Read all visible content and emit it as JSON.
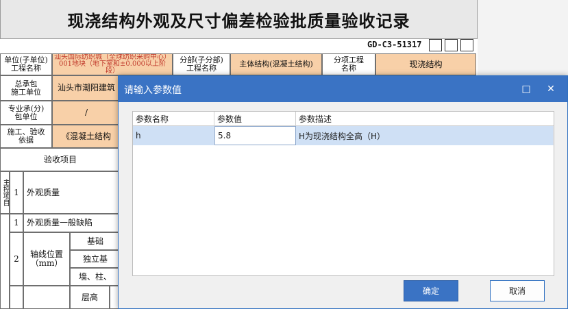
{
  "form": {
    "title": "现浇结构外观及尺寸偏差检验批质量验收记录",
    "code": "GD-C3-51317",
    "row1": {
      "unit_label": "单位(子单位)\n工程名称",
      "unit_value": "汕头国际纺织城（全球纺织采购中心）001地块（地下室和±0.000以上阶段）",
      "sub_label": "分部(子分部)\n工程名称",
      "sub_value": "主体结构(混凝土结构)",
      "item_label": "分项工程\n名称",
      "item_value": "现浇结构"
    },
    "row2": {
      "label": "总承包\n施工单位",
      "value": "汕头市潮阳建筑"
    },
    "row3": {
      "label": "专业承(分)\n包单位",
      "value": "/"
    },
    "row4": {
      "label": "施工、验收\n依据",
      "value": "《混凝土结构"
    },
    "section_header": "验收项目",
    "main_group_label": "主控项目",
    "main_items": [
      {
        "num": "1",
        "name": "外观质量"
      }
    ],
    "general_items": [
      {
        "num": "1",
        "name": "外观质量一般缺陷"
      },
      {
        "num": "2",
        "name": "轴线位置\n（mm）"
      }
    ],
    "sub_items": [
      "基础",
      "独立基",
      "墙、柱、",
      "层高"
    ]
  },
  "dialog": {
    "title": "请输入参数值",
    "columns": [
      "参数名称",
      "参数值",
      "参数描述"
    ],
    "rows": [
      {
        "name": "h",
        "value": "5.8",
        "desc": "H为现浇结构全高（H）"
      }
    ],
    "ok_label": "确定",
    "cancel_label": "取消",
    "maximize_icon": "□",
    "close_icon": "✕"
  },
  "colors": {
    "accent": "#3a73c4",
    "peach": "#f8d0a8",
    "selected_row": "#cfe0f5"
  }
}
